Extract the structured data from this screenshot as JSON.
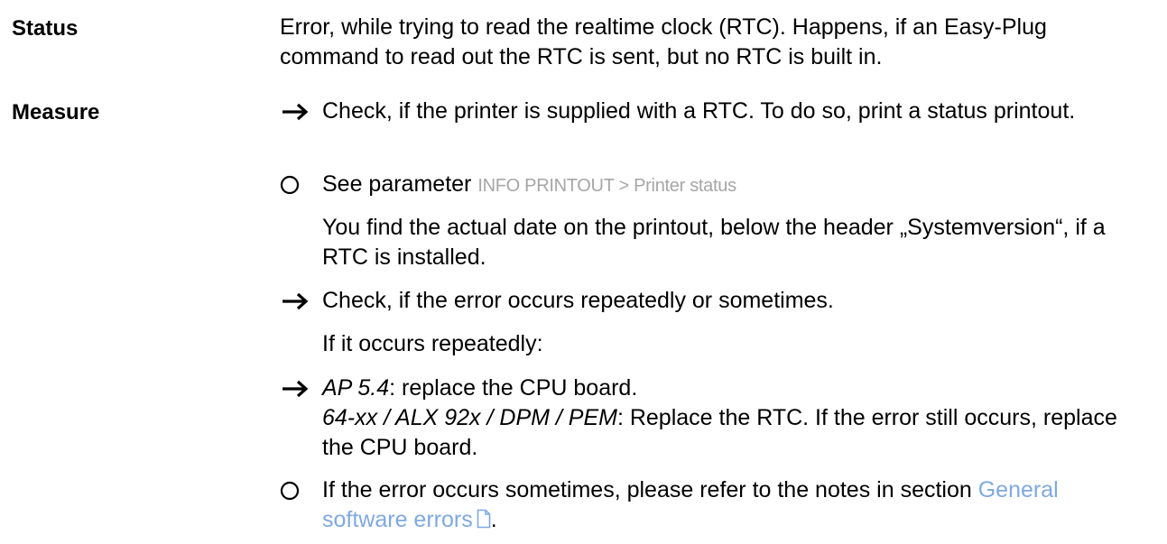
{
  "status": {
    "label": "Status",
    "text": "Error, while trying to read the realtime clock (RTC). Happens, if an Easy-Plug command to read out the RTC is sent, but no RTC is built in."
  },
  "measure": {
    "label": "Measure",
    "steps": {
      "check_rtc": "Check, if the printer is supplied with a RTC. To do so, print a status printout.",
      "see_param_prefix": "See parameter",
      "see_param_value": "INFO PRINTOUT > Printer status",
      "actual_date_note": "You find the actual date on the printout, below the header „Systemversion“, if a RTC is installed.",
      "check_repeat": "Check, if the error occurs repeatedly or sometimes.",
      "if_repeat": "If it occurs repeatedly:",
      "ap_model": "AP 5.4",
      "ap_action": ": replace the CPU board.",
      "other_models": "64-xx / ALX 92x / DPM / PEM",
      "other_action": ": Replace the RTC. If the error still occurs, replace the CPU board.",
      "sometimes_prefix": "If the error occurs sometimes, please refer to the notes in section",
      "sometimes_link": "General software errors",
      "sometimes_suffix": "."
    }
  },
  "icons": {
    "arrow": "right-arrow-icon",
    "circle": "hollow-circle-icon",
    "document": "document-icon"
  },
  "colors": {
    "text": "#000000",
    "parameter": "#a6a6a6",
    "link": "#7fa9e0"
  }
}
